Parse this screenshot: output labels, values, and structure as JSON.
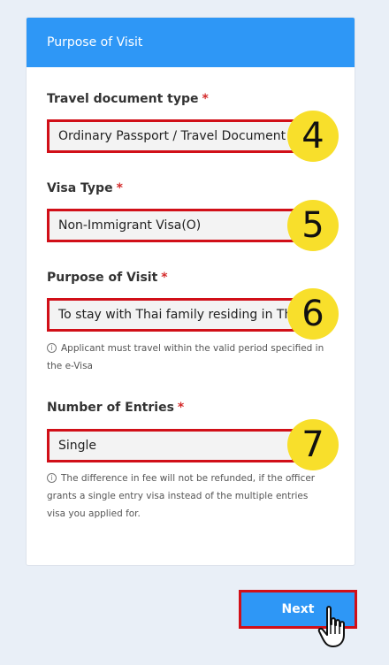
{
  "card": {
    "title": "Purpose of Visit"
  },
  "fields": {
    "travel_document": {
      "label": "Travel document type",
      "required": "*",
      "value": "Ordinary Passport / Travel Document",
      "step": "4"
    },
    "visa_type": {
      "label": "Visa Type",
      "required": "*",
      "value": "Non-Immigrant Visa(O)",
      "step": "5"
    },
    "purpose": {
      "label": "Purpose of Visit",
      "required": "*",
      "value": "To stay with Thai family residing in Thailand",
      "step": "6",
      "hint_line1": "Applicant must travel within the valid period specified in",
      "hint_line2": "the e-Visa"
    },
    "entries": {
      "label": "Number of Entries",
      "required": "*",
      "value": "Single",
      "step": "7",
      "hint_line1": "The difference in fee will not be refunded, if the officer",
      "hint_line2": "grants a single entry visa instead of the multiple entries",
      "hint_line3": "visa you applied for."
    }
  },
  "next_button": {
    "label": "Next"
  },
  "colors": {
    "accent": "#2e97f6",
    "highlight": "#d10f18",
    "badge": "#f8df2b"
  }
}
